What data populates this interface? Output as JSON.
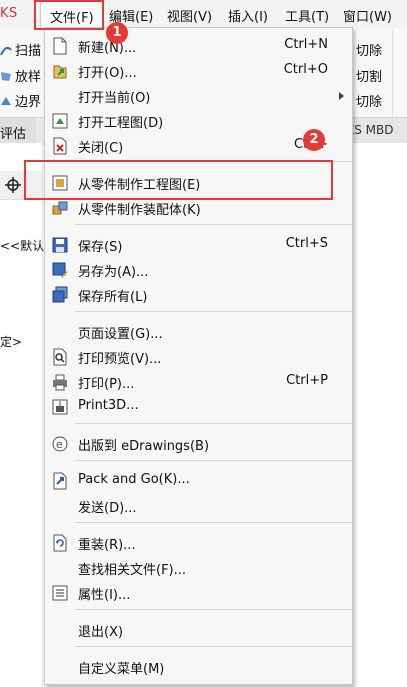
{
  "app": {
    "title_fragment": "KS"
  },
  "menubar": {
    "items": [
      {
        "label": "文件(F)"
      },
      {
        "label": "编辑(E)"
      },
      {
        "label": "视图(V)"
      },
      {
        "label": "插入(I)"
      },
      {
        "label": "工具(T)"
      },
      {
        "label": "窗口(W)"
      }
    ]
  },
  "toolbar": {
    "left_items": [
      "扫描",
      "放样",
      "边界"
    ],
    "right_items": [
      "切除",
      "切割",
      "切除"
    ]
  },
  "tabs": {
    "left": "评估",
    "right": "RKS MBD"
  },
  "side": {
    "line1": "<<默认",
    "line2": "定>"
  },
  "file_menu": {
    "items": [
      {
        "label": "新建(N)...",
        "shortcut": "Ctrl+N",
        "icon": "new-document-icon"
      },
      {
        "label": "打开(O)...",
        "shortcut": "Ctrl+O",
        "icon": "open-arrow-icon"
      },
      {
        "label": "打开当前(O)",
        "shortcut": "",
        "icon": ""
      },
      {
        "label": "打开工程图(D)",
        "shortcut": "",
        "icon": "open-drawing-icon"
      },
      {
        "label": "关闭(C)",
        "shortcut": "Ctrl+",
        "icon": "close-document-icon"
      },
      {
        "label": "从零件制作工程图(E)",
        "shortcut": "",
        "icon": "make-drawing-icon"
      },
      {
        "label": "从零件制作装配体(K)",
        "shortcut": "",
        "icon": "make-assembly-icon"
      },
      {
        "label": "保存(S)",
        "shortcut": "Ctrl+S",
        "icon": "save-icon"
      },
      {
        "label": "另存为(A)...",
        "shortcut": "",
        "icon": "save-as-icon"
      },
      {
        "label": "保存所有(L)",
        "shortcut": "",
        "icon": "save-all-icon"
      },
      {
        "label": "页面设置(G)...",
        "shortcut": "",
        "icon": ""
      },
      {
        "label": "打印预览(V)...",
        "shortcut": "",
        "icon": "print-preview-icon"
      },
      {
        "label": "打印(P)...",
        "shortcut": "Ctrl+P",
        "icon": "printer-icon"
      },
      {
        "label": "Print3D...",
        "shortcut": "",
        "icon": "print3d-icon"
      },
      {
        "label": "出版到 eDrawings(B)",
        "shortcut": "",
        "icon": "edrawings-icon"
      },
      {
        "label": "Pack and Go(K)...",
        "shortcut": "",
        "icon": "pack-and-go-icon"
      },
      {
        "label": "发送(D)...",
        "shortcut": "",
        "icon": ""
      },
      {
        "label": "重装(R)...",
        "shortcut": "",
        "icon": "reload-icon"
      },
      {
        "label": "查找相关文件(F)...",
        "shortcut": "",
        "icon": ""
      },
      {
        "label": "属性(I)...",
        "shortcut": "",
        "icon": "properties-icon"
      },
      {
        "label": "退出(X)",
        "shortcut": "",
        "icon": ""
      },
      {
        "label": "自定义菜单(M)",
        "shortcut": "",
        "icon": ""
      }
    ]
  },
  "annotations": {
    "badge1": "1",
    "badge2": "2",
    "color": "#e53935"
  }
}
